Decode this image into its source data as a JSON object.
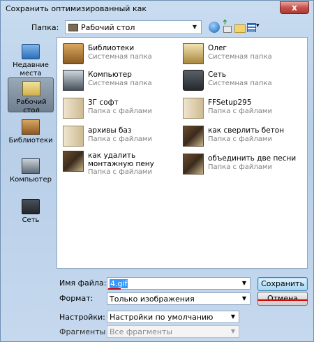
{
  "window": {
    "title": "Сохранить оптимизированный как",
    "close_glyph": "x"
  },
  "toolbar": {
    "folder_label": "Папка:",
    "location": "Рабочий стол",
    "icons": [
      "back-icon",
      "up-folder-icon",
      "new-folder-icon",
      "view-menu-icon"
    ]
  },
  "places": [
    {
      "label": "Недавние места",
      "icon": "recent-places-icon"
    },
    {
      "label": "Рабочий стол",
      "icon": "desktop-icon",
      "selected": true
    },
    {
      "label": "Библиотеки",
      "icon": "libraries-icon"
    },
    {
      "label": "Компьютер",
      "icon": "computer-icon"
    },
    {
      "label": "Сеть",
      "icon": "network-icon"
    }
  ],
  "files": [
    {
      "name": "Библиотеки",
      "type": "Системная папка",
      "icon": "libraries-folder-icon"
    },
    {
      "name": "Олег",
      "type": "Системная папка",
      "icon": "user-folder-icon"
    },
    {
      "name": "Компьютер",
      "type": "Системная папка",
      "icon": "computer-icon"
    },
    {
      "name": "Сеть",
      "type": "Системная папка",
      "icon": "network-icon"
    },
    {
      "name": "3Г софт",
      "type": "Папка с файлами",
      "icon": "folder-icon"
    },
    {
      "name": "FFSetup295",
      "type": "Папка с файлами",
      "icon": "folder-icon"
    },
    {
      "name": "архивы баз",
      "type": "Папка с файлами",
      "icon": "folder-icon"
    },
    {
      "name": "как сверлить бетон",
      "type": "Папка с файлами",
      "icon": "image-folder-icon"
    },
    {
      "name": "как удалить монтажную пену",
      "type": "Папка с файлами",
      "icon": "image-folder-icon"
    },
    {
      "name": "объединить две песни",
      "type": "Папка с файлами",
      "icon": "image-folder-icon"
    }
  ],
  "form": {
    "filename_label": "Имя файла:",
    "filename_value": "4.gif",
    "format_label": "Формат:",
    "format_value": "Только изображения",
    "settings_label": "Настройки:",
    "settings_value": "Настройки по умолчанию",
    "fragments_label": "Фрагменты",
    "fragments_value": "Все фрагменты"
  },
  "buttons": {
    "save": "Сохранить",
    "cancel": "Отмена"
  },
  "colors": {
    "selection": "#3399ff",
    "annotation_underline": "#d40000"
  }
}
